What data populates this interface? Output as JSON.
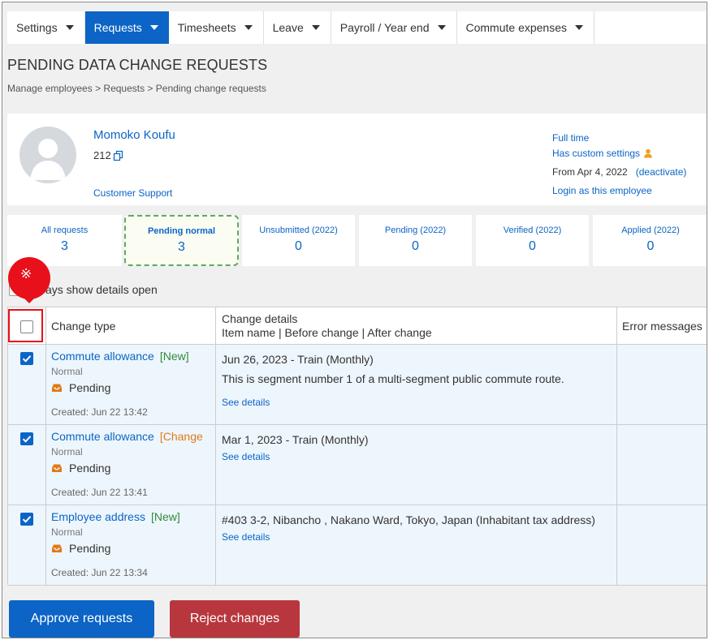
{
  "nav": {
    "items": [
      {
        "label": "Settings"
      },
      {
        "label": "Requests"
      },
      {
        "label": "Timesheets"
      },
      {
        "label": "Leave"
      },
      {
        "label": "Payroll / Year end"
      },
      {
        "label": "Commute expenses"
      }
    ],
    "active": "Requests"
  },
  "page": {
    "title": "PENDING DATA CHANGE REQUESTS",
    "breadcrumb": "Manage employees > Requests > Pending change requests"
  },
  "employee": {
    "name": "Momoko Koufu",
    "id": "212",
    "department": "Customer Support",
    "employment_type": "Full time",
    "custom_settings": "Has custom settings",
    "from_date": "From Apr 4, 2022",
    "deactivate": "(deactivate)",
    "login_as": "Login as this employee"
  },
  "tabs": [
    {
      "label": "All requests",
      "count": "3"
    },
    {
      "label": "Pending normal",
      "count": "3"
    },
    {
      "label": "Unsubmitted (2022)",
      "count": "0"
    },
    {
      "label": "Pending (2022)",
      "count": "0"
    },
    {
      "label": "Verified (2022)",
      "count": "0"
    },
    {
      "label": "Applied (2022)",
      "count": "0"
    }
  ],
  "always_show": "ays show details open",
  "marker_symbol": "※",
  "table": {
    "headers": {
      "change_type": "Change type",
      "change_details": "Change details",
      "change_details_sub": "Item name | Before change | After change",
      "error_messages": "Error messages"
    },
    "rows": [
      {
        "type": "Commute allowance",
        "tag": "[New]",
        "kind": "Normal",
        "status": "Pending",
        "created": "Created: Jun 22 13:42",
        "detail1": "Jun 26, 2023 - Train (Monthly)",
        "detail2": "This is segment number 1 of a multi-segment public commute route.",
        "see": "See details"
      },
      {
        "type": "Commute allowance",
        "tag": "[Change",
        "kind": "Normal",
        "status": "Pending",
        "created": "Created: Jun 22 13:41",
        "detail1": "Mar 1, 2023 - Train (Monthly)",
        "detail2": "",
        "see": "See details"
      },
      {
        "type": "Employee address",
        "tag": "[New]",
        "kind": "Normal",
        "status": "Pending",
        "created": "Created: Jun 22 13:34",
        "detail1": "#403 3-2, Nibancho , Nakano Ward, Tokyo, Japan (Inhabitant tax address)",
        "detail2": "",
        "see": "See details"
      }
    ]
  },
  "buttons": {
    "approve": "Approve requests",
    "reject": "Reject changes"
  },
  "colors": {
    "primary": "#0b64c6",
    "reject": "#b8373e",
    "new_tag": "#2f8a3a",
    "change_tag": "#e07a16",
    "marker": "#e8101a",
    "row_bg": "#eef6fd"
  }
}
